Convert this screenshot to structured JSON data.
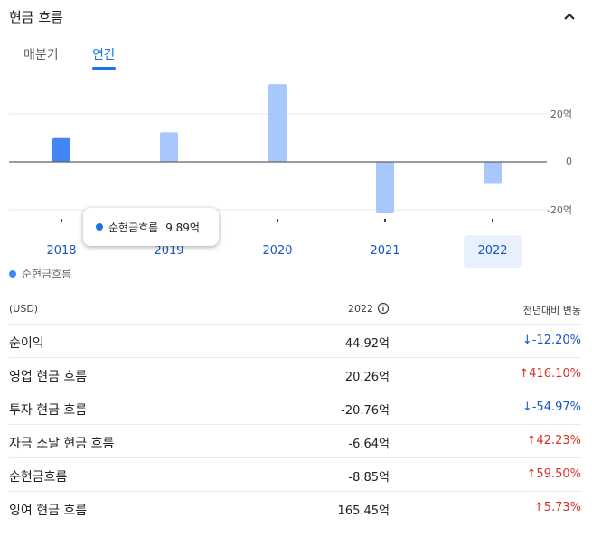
{
  "header": {
    "title": "현금 흐름"
  },
  "tabs": [
    {
      "label": "매분기"
    },
    {
      "label": "연간"
    }
  ],
  "chart_data": {
    "type": "bar",
    "categories": [
      "2018",
      "2019",
      "2020",
      "2021",
      "2022"
    ],
    "series": [
      {
        "name": "순현금흐름",
        "values": [
          9.89,
          12.3,
          32.4,
          -21.5,
          -8.85
        ]
      }
    ],
    "ylim": [
      -20,
      20
    ],
    "yticks": [
      "20억",
      "0",
      "-20억"
    ],
    "selected_index": 0,
    "tooltip": {
      "label": "순현금흐름",
      "value": "9.89억"
    },
    "colors": {
      "selected": "#4285f4",
      "normal": "#a8c7fa"
    }
  },
  "legend": {
    "label": "순현금흐름"
  },
  "table": {
    "headers": {
      "unit": "(USD)",
      "year": "2022",
      "change": "전년대비 변동"
    },
    "rows": [
      {
        "name": "순이익",
        "value": "44.92억",
        "change": "-12.20%",
        "dir": "down"
      },
      {
        "name": "영업 현금 흐름",
        "value": "20.26억",
        "change": "416.10%",
        "dir": "up"
      },
      {
        "name": "투자 현금 흐름",
        "value": "-20.76억",
        "change": "-54.97%",
        "dir": "down"
      },
      {
        "name": "자금 조달 현금 흐름",
        "value": "-6.64억",
        "change": "42.23%",
        "dir": "up"
      },
      {
        "name": "순현금흐름",
        "value": "-8.85억",
        "change": "59.50%",
        "dir": "up"
      },
      {
        "name": "잉여 현금 흐름",
        "value": "165.45억",
        "change": "5.73%",
        "dir": "up"
      }
    ]
  }
}
